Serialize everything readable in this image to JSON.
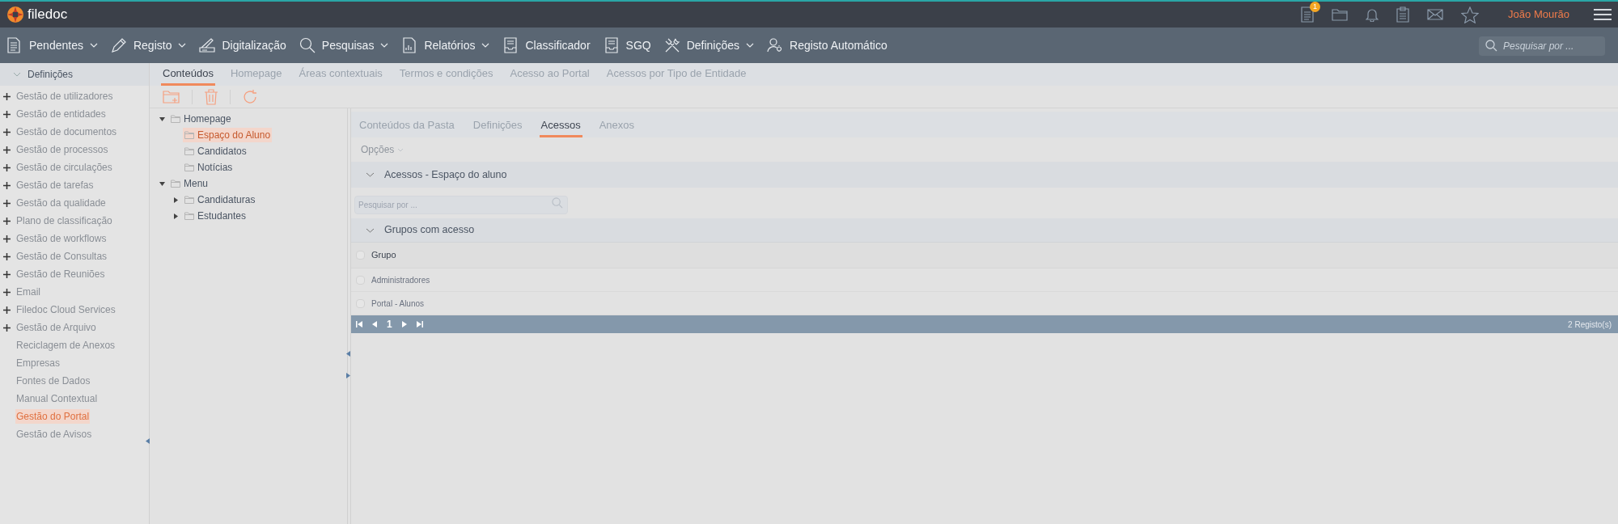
{
  "header": {
    "logo_text": "filedoc",
    "notification_count": "1",
    "user_name": "João Mourão"
  },
  "nav": {
    "items": [
      {
        "label": "Pendentes",
        "dropdown": true
      },
      {
        "label": "Registo",
        "dropdown": true
      },
      {
        "label": "Digitalização",
        "dropdown": false
      },
      {
        "label": "Pesquisas",
        "dropdown": true
      },
      {
        "label": "Relatórios",
        "dropdown": true
      },
      {
        "label": "Classificador",
        "dropdown": false
      },
      {
        "label": "SGQ",
        "dropdown": false
      },
      {
        "label": "Definições",
        "dropdown": true
      },
      {
        "label": "Registo Automático",
        "dropdown": false
      }
    ],
    "search": {
      "placeholder": "Pesquisar por ..."
    }
  },
  "sidebar": {
    "title": "Definições",
    "items": [
      {
        "label": "Gestão de utilizadores",
        "expandable": true,
        "selected": false
      },
      {
        "label": "Gestão de entidades",
        "expandable": true,
        "selected": false
      },
      {
        "label": "Gestão de documentos",
        "expandable": true,
        "selected": false
      },
      {
        "label": "Gestão de processos",
        "expandable": true,
        "selected": false
      },
      {
        "label": "Gestão de circulações",
        "expandable": true,
        "selected": false
      },
      {
        "label": "Gestão de tarefas",
        "expandable": true,
        "selected": false
      },
      {
        "label": "Gestão da qualidade",
        "expandable": true,
        "selected": false
      },
      {
        "label": "Plano de classificação",
        "expandable": true,
        "selected": false
      },
      {
        "label": "Gestão de workflows",
        "expandable": true,
        "selected": false
      },
      {
        "label": "Gestão de Consultas",
        "expandable": true,
        "selected": false
      },
      {
        "label": "Gestão de Reuniões",
        "expandable": true,
        "selected": false
      },
      {
        "label": "Email",
        "expandable": true,
        "selected": false
      },
      {
        "label": "Filedoc Cloud Services",
        "expandable": true,
        "selected": false
      },
      {
        "label": "Gestão de Arquivo",
        "expandable": true,
        "selected": false
      },
      {
        "label": "Reciclagem de Anexos",
        "expandable": false,
        "selected": false
      },
      {
        "label": "Empresas",
        "expandable": false,
        "selected": false
      },
      {
        "label": "Fontes de Dados",
        "expandable": false,
        "selected": false
      },
      {
        "label": "Manual Contextual",
        "expandable": false,
        "selected": false
      },
      {
        "label": "Gestão do Portal",
        "expandable": false,
        "selected": true
      },
      {
        "label": "Gestão de Avisos",
        "expandable": false,
        "selected": false
      }
    ]
  },
  "tabs": [
    {
      "label": "Conteúdos",
      "selected": true
    },
    {
      "label": "Homepage",
      "selected": false
    },
    {
      "label": "Áreas contextuais",
      "selected": false
    },
    {
      "label": "Termos e condições",
      "selected": false
    },
    {
      "label": "Acesso ao Portal",
      "selected": false
    },
    {
      "label": "Acessos por Tipo de Entidade",
      "selected": false
    }
  ],
  "tree": [
    {
      "label": "Homepage",
      "expanded": true,
      "selected": false,
      "children": [
        {
          "label": "Espaço do Aluno",
          "selected": true
        },
        {
          "label": "Candidatos",
          "selected": false
        },
        {
          "label": "Notícias",
          "selected": false
        }
      ]
    },
    {
      "label": "Menu",
      "expanded": true,
      "selected": false,
      "children": [
        {
          "label": "Candidaturas",
          "expanded": false,
          "selected": false
        },
        {
          "label": "Estudantes",
          "expanded": false,
          "selected": false
        }
      ]
    }
  ],
  "detail": {
    "tabs": [
      {
        "label": "Conteúdos da Pasta",
        "selected": false
      },
      {
        "label": "Definições",
        "selected": false
      },
      {
        "label": "Acessos",
        "selected": true
      },
      {
        "label": "Anexos",
        "selected": false
      }
    ],
    "options_label": "Opções",
    "section_title": "Acessos - Espaço do aluno",
    "search": {
      "placeholder": "Pesquisar por ..."
    },
    "groups_title": "Grupos com acesso",
    "table": {
      "columns": [
        "Grupo"
      ],
      "all_checked": false,
      "rows": [
        {
          "grupo": "Administradores",
          "checked": false
        },
        {
          "grupo": "Portal - Alunos",
          "checked": false
        }
      ]
    },
    "pager": {
      "page": "1",
      "count": "2 Registo(s)"
    }
  }
}
